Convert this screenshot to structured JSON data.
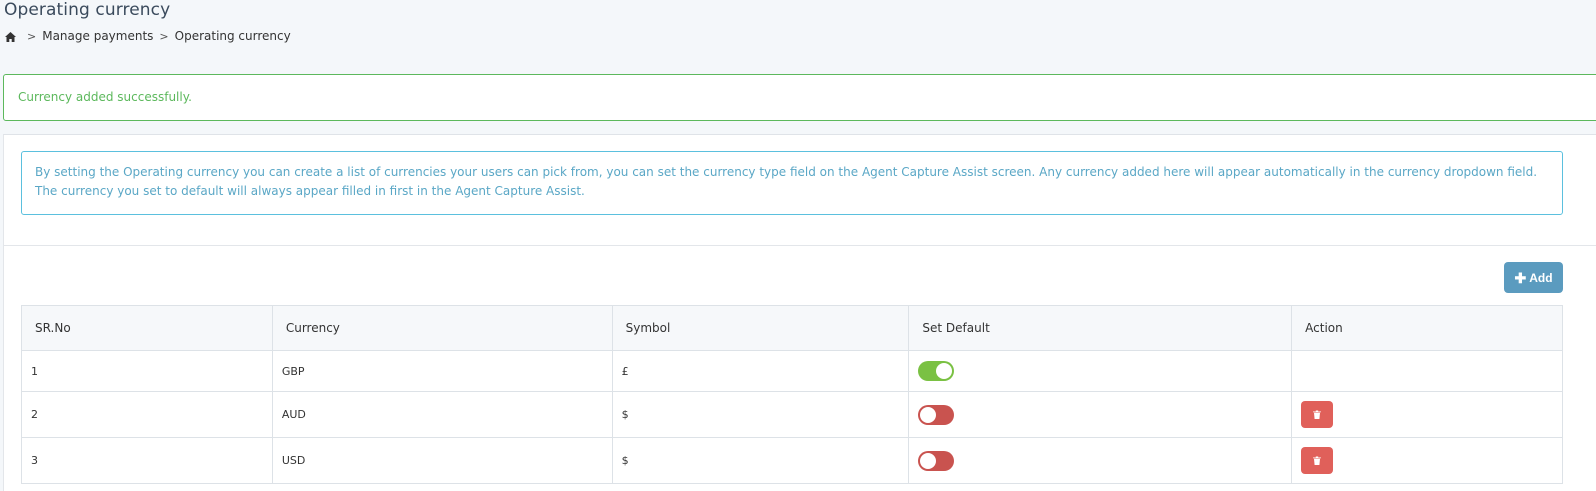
{
  "page": {
    "title": "Operating currency"
  },
  "breadcrumb": {
    "items": [
      "Manage payments",
      "Operating currency"
    ]
  },
  "alert": {
    "message": "Currency added successfully."
  },
  "info": {
    "text": "By setting the Operating currency you can create a list of currencies your users can pick from, you can set the currency type field on the Agent Capture Assist screen. Any currency added here will appear automatically in the currency dropdown field. The currency you set to default will always appear filled in first in the Agent Capture Assist."
  },
  "toolbar": {
    "add_label": "Add",
    "add_icon": "plus-icon"
  },
  "table": {
    "columns": [
      "SR.No",
      "Currency",
      "Symbol",
      "Set Default",
      "Action"
    ],
    "rows": [
      {
        "sr": "1",
        "currency": "GBP",
        "symbol": "£",
        "is_default": true
      },
      {
        "sr": "2",
        "currency": "AUD",
        "symbol": "$",
        "is_default": false
      },
      {
        "sr": "3",
        "currency": "USD",
        "symbol": "$",
        "is_default": false
      }
    ]
  },
  "colors": {
    "success": "#5cb85c",
    "info": "#5bc0de",
    "primary_button": "#5b9bbf",
    "toggle_on": "#7ac143",
    "toggle_off": "#c9534f",
    "danger": "#e0605a"
  }
}
